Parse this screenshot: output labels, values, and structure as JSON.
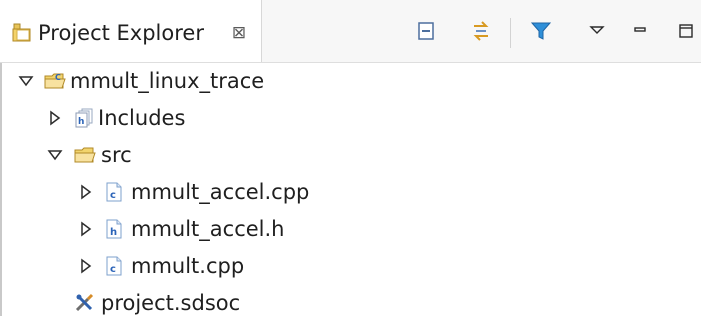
{
  "view": {
    "title": "Project Explorer",
    "close_glyph": "⊠"
  },
  "toolbar": {
    "buttons": [
      {
        "name": "collapse-all",
        "icon": "collapse-all-icon"
      },
      {
        "name": "link-with-editor",
        "icon": "link-with-editor-icon"
      },
      {
        "name": "filter",
        "icon": "filter-icon"
      },
      {
        "name": "view-menu",
        "icon": "view-menu-icon"
      },
      {
        "name": "minimize",
        "icon": "minimize-icon"
      },
      {
        "name": "maximize",
        "icon": "maximize-icon"
      }
    ]
  },
  "tree": {
    "project": {
      "label": "mmult_linux_trace",
      "expanded": true,
      "icon": "c-project-folder-icon"
    },
    "includes": {
      "label": "Includes",
      "expanded": false,
      "icon": "includes-icon"
    },
    "src": {
      "label": "src",
      "expanded": true,
      "icon": "source-folder-icon"
    },
    "files": [
      {
        "label": "mmult_accel.cpp",
        "icon": "cpp-source-file-icon",
        "expanded": false
      },
      {
        "label": "mmult_accel.h",
        "icon": "header-file-icon",
        "expanded": false
      },
      {
        "label": "mmult.cpp",
        "icon": "cpp-source-file-icon",
        "expanded": false
      }
    ],
    "project_file": {
      "label": "project.sdsoc",
      "icon": "sdsoc-project-tools-icon"
    }
  },
  "colors": {
    "folder_yellow": "#e8c45a",
    "file_blue": "#2c64b8",
    "filter_blue": "#2f8fd8",
    "link_orange": "#d89a22",
    "tool_blue": "#3d6fb4"
  }
}
